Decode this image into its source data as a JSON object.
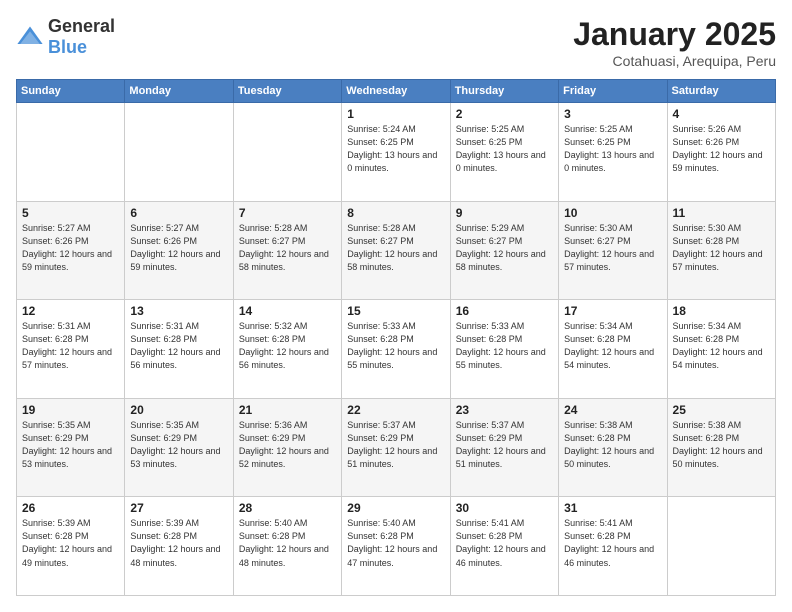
{
  "logo": {
    "general": "General",
    "blue": "Blue"
  },
  "header": {
    "month": "January 2025",
    "location": "Cotahuasi, Arequipa, Peru"
  },
  "weekdays": [
    "Sunday",
    "Monday",
    "Tuesday",
    "Wednesday",
    "Thursday",
    "Friday",
    "Saturday"
  ],
  "weeks": [
    [
      {
        "day": "",
        "info": ""
      },
      {
        "day": "",
        "info": ""
      },
      {
        "day": "",
        "info": ""
      },
      {
        "day": "1",
        "info": "Sunrise: 5:24 AM\nSunset: 6:25 PM\nDaylight: 13 hours\nand 0 minutes."
      },
      {
        "day": "2",
        "info": "Sunrise: 5:25 AM\nSunset: 6:25 PM\nDaylight: 13 hours\nand 0 minutes."
      },
      {
        "day": "3",
        "info": "Sunrise: 5:25 AM\nSunset: 6:25 PM\nDaylight: 13 hours\nand 0 minutes."
      },
      {
        "day": "4",
        "info": "Sunrise: 5:26 AM\nSunset: 6:26 PM\nDaylight: 12 hours\nand 59 minutes."
      }
    ],
    [
      {
        "day": "5",
        "info": "Sunrise: 5:27 AM\nSunset: 6:26 PM\nDaylight: 12 hours\nand 59 minutes."
      },
      {
        "day": "6",
        "info": "Sunrise: 5:27 AM\nSunset: 6:26 PM\nDaylight: 12 hours\nand 59 minutes."
      },
      {
        "day": "7",
        "info": "Sunrise: 5:28 AM\nSunset: 6:27 PM\nDaylight: 12 hours\nand 58 minutes."
      },
      {
        "day": "8",
        "info": "Sunrise: 5:28 AM\nSunset: 6:27 PM\nDaylight: 12 hours\nand 58 minutes."
      },
      {
        "day": "9",
        "info": "Sunrise: 5:29 AM\nSunset: 6:27 PM\nDaylight: 12 hours\nand 58 minutes."
      },
      {
        "day": "10",
        "info": "Sunrise: 5:30 AM\nSunset: 6:27 PM\nDaylight: 12 hours\nand 57 minutes."
      },
      {
        "day": "11",
        "info": "Sunrise: 5:30 AM\nSunset: 6:28 PM\nDaylight: 12 hours\nand 57 minutes."
      }
    ],
    [
      {
        "day": "12",
        "info": "Sunrise: 5:31 AM\nSunset: 6:28 PM\nDaylight: 12 hours\nand 57 minutes."
      },
      {
        "day": "13",
        "info": "Sunrise: 5:31 AM\nSunset: 6:28 PM\nDaylight: 12 hours\nand 56 minutes."
      },
      {
        "day": "14",
        "info": "Sunrise: 5:32 AM\nSunset: 6:28 PM\nDaylight: 12 hours\nand 56 minutes."
      },
      {
        "day": "15",
        "info": "Sunrise: 5:33 AM\nSunset: 6:28 PM\nDaylight: 12 hours\nand 55 minutes."
      },
      {
        "day": "16",
        "info": "Sunrise: 5:33 AM\nSunset: 6:28 PM\nDaylight: 12 hours\nand 55 minutes."
      },
      {
        "day": "17",
        "info": "Sunrise: 5:34 AM\nSunset: 6:28 PM\nDaylight: 12 hours\nand 54 minutes."
      },
      {
        "day": "18",
        "info": "Sunrise: 5:34 AM\nSunset: 6:28 PM\nDaylight: 12 hours\nand 54 minutes."
      }
    ],
    [
      {
        "day": "19",
        "info": "Sunrise: 5:35 AM\nSunset: 6:29 PM\nDaylight: 12 hours\nand 53 minutes."
      },
      {
        "day": "20",
        "info": "Sunrise: 5:35 AM\nSunset: 6:29 PM\nDaylight: 12 hours\nand 53 minutes."
      },
      {
        "day": "21",
        "info": "Sunrise: 5:36 AM\nSunset: 6:29 PM\nDaylight: 12 hours\nand 52 minutes."
      },
      {
        "day": "22",
        "info": "Sunrise: 5:37 AM\nSunset: 6:29 PM\nDaylight: 12 hours\nand 51 minutes."
      },
      {
        "day": "23",
        "info": "Sunrise: 5:37 AM\nSunset: 6:29 PM\nDaylight: 12 hours\nand 51 minutes."
      },
      {
        "day": "24",
        "info": "Sunrise: 5:38 AM\nSunset: 6:28 PM\nDaylight: 12 hours\nand 50 minutes."
      },
      {
        "day": "25",
        "info": "Sunrise: 5:38 AM\nSunset: 6:28 PM\nDaylight: 12 hours\nand 50 minutes."
      }
    ],
    [
      {
        "day": "26",
        "info": "Sunrise: 5:39 AM\nSunset: 6:28 PM\nDaylight: 12 hours\nand 49 minutes."
      },
      {
        "day": "27",
        "info": "Sunrise: 5:39 AM\nSunset: 6:28 PM\nDaylight: 12 hours\nand 48 minutes."
      },
      {
        "day": "28",
        "info": "Sunrise: 5:40 AM\nSunset: 6:28 PM\nDaylight: 12 hours\nand 48 minutes."
      },
      {
        "day": "29",
        "info": "Sunrise: 5:40 AM\nSunset: 6:28 PM\nDaylight: 12 hours\nand 47 minutes."
      },
      {
        "day": "30",
        "info": "Sunrise: 5:41 AM\nSunset: 6:28 PM\nDaylight: 12 hours\nand 46 minutes."
      },
      {
        "day": "31",
        "info": "Sunrise: 5:41 AM\nSunset: 6:28 PM\nDaylight: 12 hours\nand 46 minutes."
      },
      {
        "day": "",
        "info": ""
      }
    ]
  ]
}
